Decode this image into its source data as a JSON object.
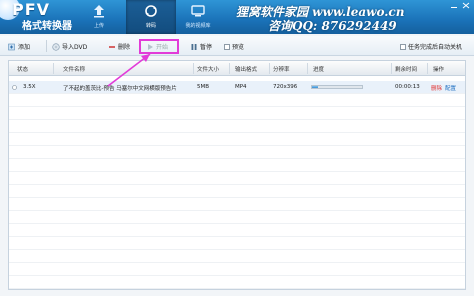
{
  "app": {
    "logo": "PFV",
    "subtitle": "格式转换器"
  },
  "nav": [
    {
      "label": "上传",
      "icon": "upload-icon"
    },
    {
      "label": "转码",
      "icon": "convert-icon",
      "active": true
    },
    {
      "label": "我的视频库",
      "icon": "library-icon"
    }
  ],
  "brand": {
    "text": "狸窝软件家园 www.leawo.cn",
    "contact": "咨询QQ: 876292449"
  },
  "toolbar": {
    "add": "添加",
    "import_dvd": "导入DVD",
    "delete": "删除",
    "start": "开始",
    "pause": "暂停",
    "preview": "预览",
    "auto_shutdown": "任务完成后自动关机"
  },
  "table": {
    "headers": [
      "状态",
      "文件名称",
      "文件大小",
      "输出格式",
      "分辨率",
      "进度",
      "剩余时间",
      "操作"
    ],
    "rows": [
      {
        "status": "3.5X",
        "filename": "了不起的盖茨比-预告 马塞尔中文网横版预告片",
        "size": "5MB",
        "format": "MP4",
        "resolution": "720x396",
        "progress": 0.12,
        "remaining": "00:00:13",
        "action_delete": "删除",
        "action_config": "配置"
      }
    ]
  },
  "colors": {
    "header": "#1a72b8",
    "highlight": "#e23bd8"
  }
}
